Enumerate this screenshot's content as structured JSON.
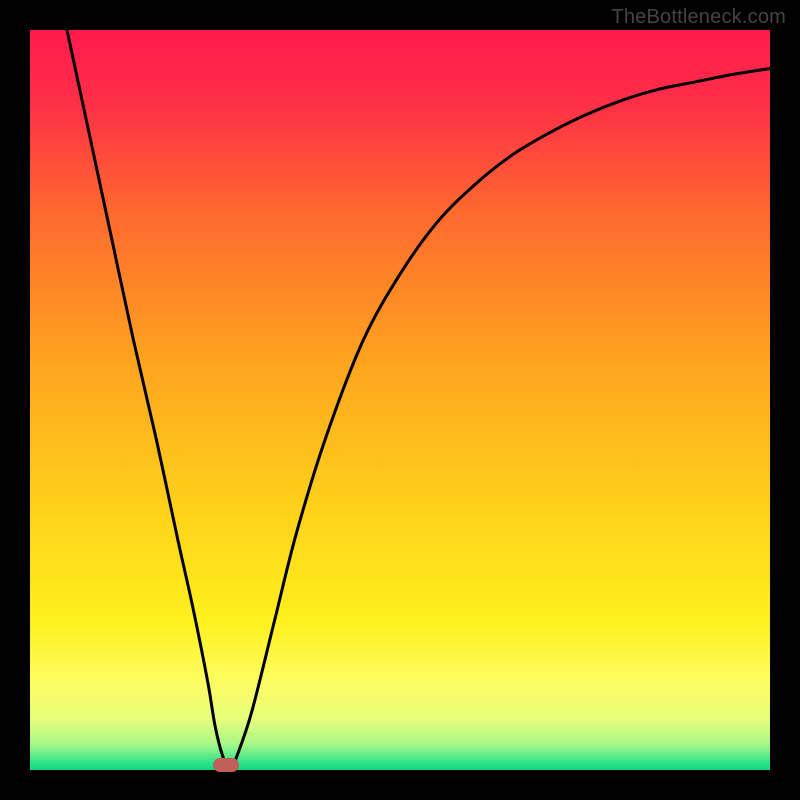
{
  "watermark": "TheBottleneck.com",
  "chart_data": {
    "type": "line",
    "title": "",
    "xlabel": "",
    "ylabel": "",
    "xlim": [
      0,
      100
    ],
    "ylim": [
      0,
      100
    ],
    "gradient_stops": [
      {
        "offset": 0.0,
        "color": "#ff1a4d"
      },
      {
        "offset": 0.1,
        "color": "#ff2f46"
      },
      {
        "offset": 0.25,
        "color": "#ff6a2e"
      },
      {
        "offset": 0.45,
        "color": "#ffa41f"
      },
      {
        "offset": 0.65,
        "color": "#ffd21a"
      },
      {
        "offset": 0.8,
        "color": "#fff01e"
      },
      {
        "offset": 0.88,
        "color": "#fdfd60"
      },
      {
        "offset": 0.93,
        "color": "#e8fd7a"
      },
      {
        "offset": 0.965,
        "color": "#a8f888"
      },
      {
        "offset": 0.99,
        "color": "#2fe28b"
      },
      {
        "offset": 1.0,
        "color": "#12d687"
      }
    ],
    "series": [
      {
        "name": "bottleneck-curve",
        "x": [
          5,
          8,
          11,
          14,
          17,
          20,
          22,
          24,
          25,
          26,
          27,
          28,
          30,
          33,
          36,
          40,
          45,
          50,
          55,
          60,
          65,
          70,
          75,
          80,
          85,
          90,
          95,
          100
        ],
        "y": [
          100,
          86,
          72,
          58,
          45,
          31,
          22,
          12,
          6,
          2,
          0,
          2,
          8,
          20,
          32,
          45,
          58,
          67,
          74,
          79,
          83,
          86,
          88.5,
          90.5,
          92,
          93,
          94,
          94.8
        ]
      }
    ],
    "marker": {
      "x": 26.5,
      "y": 0,
      "color": "#c1605b"
    }
  }
}
